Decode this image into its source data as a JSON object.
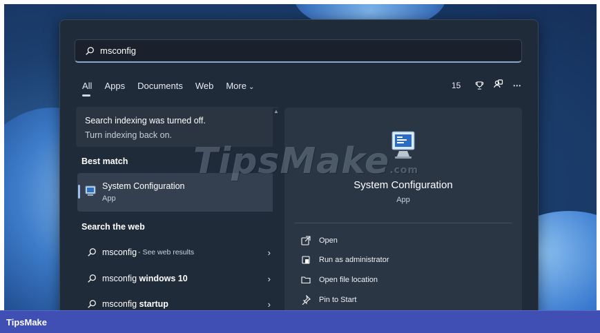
{
  "search": {
    "value": "msconfig"
  },
  "tabs": [
    {
      "label": "All",
      "active": true
    },
    {
      "label": "Apps"
    },
    {
      "label": "Documents"
    },
    {
      "label": "Web"
    },
    {
      "label": "More"
    }
  ],
  "header_right": {
    "points": "15",
    "icons": [
      "trophy-icon",
      "account-icon",
      "more-icon"
    ]
  },
  "notice": {
    "line1": "Search indexing was turned off.",
    "line2": "Turn indexing back on."
  },
  "best_match": {
    "heading": "Best match",
    "name": "System Configuration",
    "type": "App"
  },
  "search_web": {
    "heading": "Search the web",
    "items": [
      {
        "query": "msconfig",
        "suffix": " - See web results"
      },
      {
        "query": "msconfig",
        "bold": "windows 10"
      },
      {
        "query": "msconfig",
        "bold": "startup"
      }
    ]
  },
  "details": {
    "name": "System Configuration",
    "type": "App",
    "actions": [
      "Open",
      "Run as administrator",
      "Open file location",
      "Pin to Start"
    ]
  },
  "watermark": {
    "text": "TipsMake",
    "suffix": ".com"
  },
  "footer": {
    "brand": "TipsMake"
  },
  "colors": {
    "accent": "#3f4fb3",
    "panel": "#202b3a",
    "selected": "#34404f"
  }
}
